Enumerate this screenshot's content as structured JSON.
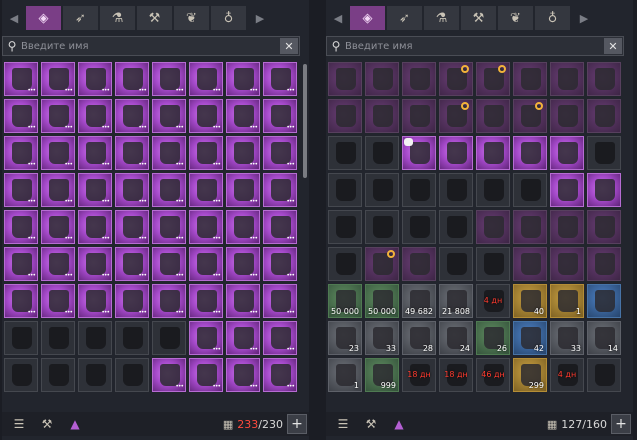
{
  "left": {
    "tabs": [
      {
        "icon": "all-items-icon",
        "glyph": "◈",
        "active": true
      },
      {
        "icon": "weapon-bow-icon",
        "glyph": "➶",
        "active": false
      },
      {
        "icon": "potion-icon",
        "glyph": "⚗",
        "active": false
      },
      {
        "icon": "anvil-icon",
        "glyph": "⚒",
        "active": false
      },
      {
        "icon": "herb-icon",
        "glyph": "❦",
        "active": false
      },
      {
        "icon": "pouch-icon",
        "glyph": "♁",
        "active": false
      }
    ],
    "search_placeholder": "Введите имя",
    "slots": [
      "p",
      "p",
      "p",
      "p",
      "p",
      "p",
      "p",
      "p",
      "p",
      "p",
      "p",
      "p",
      "p",
      "p",
      "p",
      "p",
      "p",
      "p",
      "p",
      "p",
      "p",
      "p",
      "p",
      "p",
      "p",
      "p",
      "p",
      "p",
      "p",
      "p",
      "p",
      "p",
      "p",
      "p",
      "p",
      "p",
      "p",
      "p",
      "p",
      "p",
      "p",
      "p",
      "p",
      "p",
      "p",
      "p",
      "p",
      "p",
      "p",
      "p",
      "p",
      "p",
      "p",
      "p",
      "p",
      "p",
      "d",
      "d",
      "d",
      "d",
      "d",
      "p",
      "p",
      "p",
      "d",
      "d",
      "d",
      "d",
      "p",
      "p",
      "p",
      "p"
    ],
    "capacity": {
      "used": "233",
      "total": "230",
      "over": true
    }
  },
  "right": {
    "tabs": [
      {
        "icon": "all-items-icon",
        "glyph": "◈",
        "active": true
      },
      {
        "icon": "weapon-bow-icon",
        "glyph": "➶",
        "active": false
      },
      {
        "icon": "potion-icon",
        "glyph": "⚗",
        "active": false
      },
      {
        "icon": "anvil-icon",
        "glyph": "⚒",
        "active": false
      },
      {
        "icon": "herb-icon",
        "glyph": "❦",
        "active": false
      },
      {
        "icon": "pouch-icon",
        "glyph": "♁",
        "active": false
      }
    ],
    "search_placeholder": "Введите имя",
    "slots": [
      {
        "c": "dp"
      },
      {
        "c": "dp"
      },
      {
        "c": "dp"
      },
      {
        "c": "dp",
        "lock": true
      },
      {
        "c": "dp",
        "lock": true
      },
      {
        "c": "dp"
      },
      {
        "c": "dp"
      },
      {
        "c": "dp"
      },
      {
        "c": "dp"
      },
      {
        "c": "dp"
      },
      {
        "c": "dp"
      },
      {
        "c": "dp",
        "lock": true
      },
      {
        "c": "dp"
      },
      {
        "c": "dp",
        "lock": true
      },
      {
        "c": "dp"
      },
      {
        "c": "dp"
      },
      {
        "c": "d"
      },
      {
        "c": "d"
      },
      {
        "c": "p",
        "badge": true
      },
      {
        "c": "p"
      },
      {
        "c": "p"
      },
      {
        "c": "p"
      },
      {
        "c": "p"
      },
      {
        "c": "d"
      },
      {
        "c": "d"
      },
      {
        "c": "d"
      },
      {
        "c": "d"
      },
      {
        "c": "d"
      },
      {
        "c": "d"
      },
      {
        "c": "d"
      },
      {
        "c": "p"
      },
      {
        "c": "p"
      },
      {
        "c": "d"
      },
      {
        "c": "d"
      },
      {
        "c": "d"
      },
      {
        "c": "d"
      },
      {
        "c": "dp"
      },
      {
        "c": "dp"
      },
      {
        "c": "dp"
      },
      {
        "c": "dp"
      },
      {
        "c": "d"
      },
      {
        "c": "dp",
        "lock": true
      },
      {
        "c": "dp"
      },
      {
        "c": "d"
      },
      {
        "c": "d"
      },
      {
        "c": "dp"
      },
      {
        "c": "dp"
      },
      {
        "c": "dp"
      },
      {
        "c": "g",
        "q": "50 000"
      },
      {
        "c": "g",
        "q": "50 000"
      },
      {
        "c": "gr",
        "q": "49 682"
      },
      {
        "c": "gr",
        "q": "21 808"
      },
      {
        "c": "d",
        "t": "4 дн"
      },
      {
        "c": "y",
        "q": "40"
      },
      {
        "c": "y",
        "q": "1"
      },
      {
        "c": "b"
      },
      {
        "c": "gr",
        "q": "23"
      },
      {
        "c": "gr",
        "q": "33"
      },
      {
        "c": "gr",
        "q": "28"
      },
      {
        "c": "gr",
        "q": "24"
      },
      {
        "c": "g",
        "q": "26"
      },
      {
        "c": "b",
        "q": "42"
      },
      {
        "c": "gr",
        "q": "33"
      },
      {
        "c": "gr",
        "q": "14"
      },
      {
        "c": "gr",
        "q": "1"
      },
      {
        "c": "g",
        "q": "999"
      },
      {
        "c": "d",
        "t": "18 дн"
      },
      {
        "c": "d",
        "t": "18 дн"
      },
      {
        "c": "d",
        "t": "46 дн"
      },
      {
        "c": "y",
        "q": "299"
      },
      {
        "c": "d",
        "t": "4 дн"
      },
      {
        "c": "d"
      }
    ],
    "capacity": {
      "used": "127",
      "total": "160",
      "over": false
    }
  },
  "footer": {
    "sort_icon": "sort-icon",
    "anvil_icon": "anvil-icon",
    "filter_icon": "grade-filter-icon",
    "grid_icon": "grid-icon"
  },
  "colors": {
    "accent": "#a449c9",
    "over_capacity": "#ff4a3d"
  }
}
